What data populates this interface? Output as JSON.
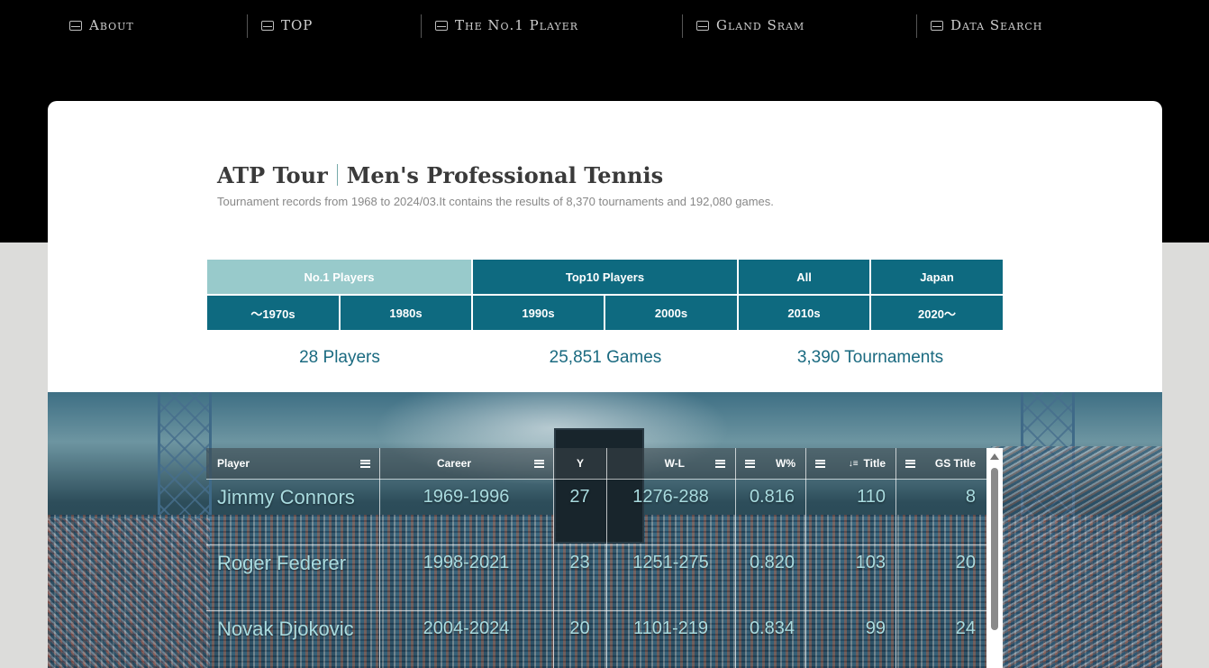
{
  "nav": {
    "items": [
      {
        "label": "About"
      },
      {
        "label": "TOP"
      },
      {
        "label": "The No.1 Player"
      },
      {
        "label": "Gland Sram"
      },
      {
        "label": "Data Search"
      }
    ]
  },
  "header": {
    "title_main": "ATP Tour",
    "title_sub": "Men's Professional Tennis",
    "subtitle": "Tournament records from 1968 to 2024/03.It contains the results of 8,370 tournaments and 192,080 games."
  },
  "tabs": {
    "row1": [
      {
        "label": "No.1 Players",
        "active": true
      },
      {
        "label": "Top10 Players",
        "active": false
      },
      {
        "label": "All",
        "active": false
      },
      {
        "label": "Japan",
        "active": false
      }
    ],
    "row2": [
      {
        "label": "〜1970s"
      },
      {
        "label": "1980s"
      },
      {
        "label": "1990s"
      },
      {
        "label": "2000s"
      },
      {
        "label": "2010s"
      },
      {
        "label": "2020〜"
      }
    ]
  },
  "stats": {
    "players": "28 Players",
    "games": "25,851 Games",
    "tournaments": "3,390 Tournaments"
  },
  "table": {
    "headers": {
      "player": "Player",
      "career": "Career",
      "y": "Y",
      "wl": "W-L",
      "wpct": "W%",
      "title": "Title",
      "gs_title": "GS Title"
    },
    "rows": [
      {
        "player": "Jimmy Connors",
        "career": "1969-1996",
        "y": "27",
        "wl": "1276-288",
        "wpct": "0.816",
        "title": "110",
        "gs_title": "8"
      },
      {
        "player": "Roger Federer",
        "career": "1998-2021",
        "y": "23",
        "wl": "1251-275",
        "wpct": "0.820",
        "title": "103",
        "gs_title": "20"
      },
      {
        "player": "Novak Djokovic",
        "career": "2004-2024",
        "y": "20",
        "wl": "1101-219",
        "wpct": "0.834",
        "title": "99",
        "gs_title": "24"
      }
    ]
  },
  "colors": {
    "tab_bg": "#0e6a80",
    "tab_active": "#98cacb",
    "stat_text": "#1a6a80",
    "cell_text": "#a9dbdf"
  }
}
